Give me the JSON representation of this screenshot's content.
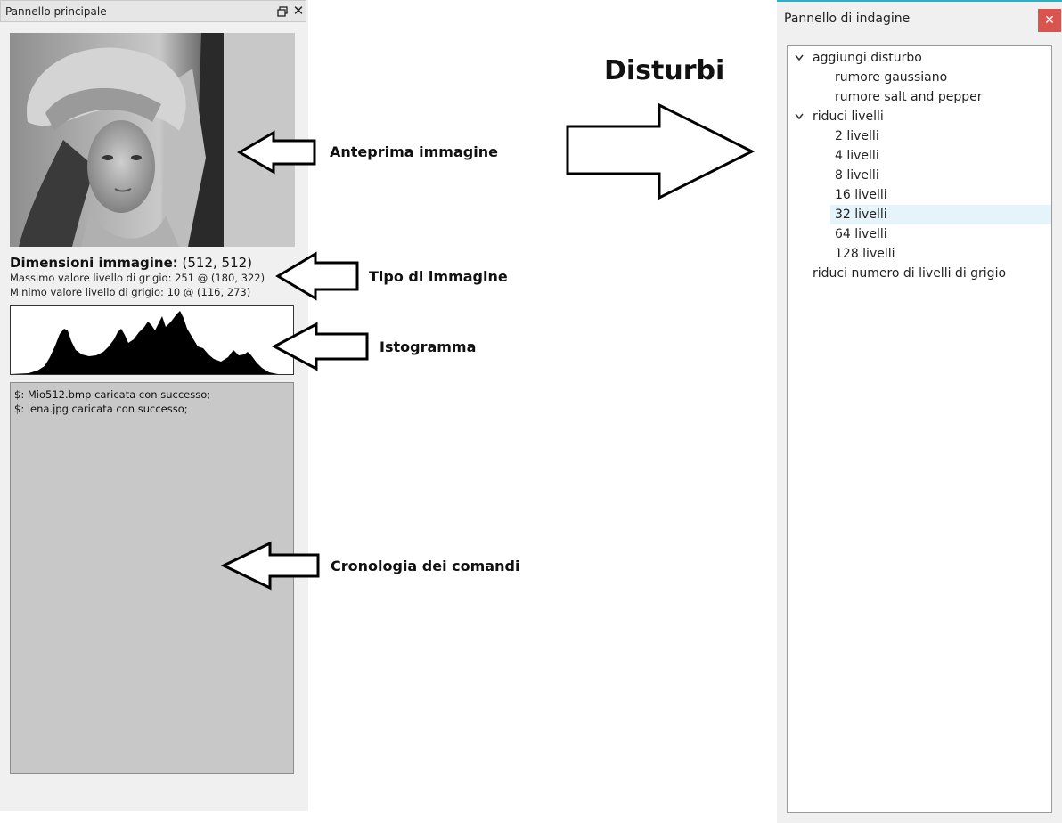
{
  "left_panel": {
    "title": "Pannello principale",
    "dimensions_label": "Dimensioni immagine:",
    "dimensions_value": "(512, 512)",
    "max_line": "Massimo valore livello di grigio: 251 @ (180, 322)",
    "min_line": "Minimo valore livello di grigio: 10 @ (116, 273)",
    "console_lines": [
      "$: Mio512.bmp caricata con successo;",
      "$: lena.jpg caricata con successo;"
    ]
  },
  "annotations": {
    "heading": "Disturbi",
    "preview": "Anteprima immagine",
    "type": "Tipo di immagine",
    "histogram": "Istogramma",
    "history": "Cronologia dei comandi"
  },
  "right_panel": {
    "title": "Pannello di indagine",
    "close_icon": "close-icon",
    "tree": [
      {
        "label": "aggiungi disturbo",
        "expanded": true
      },
      {
        "label": "rumore gaussiano"
      },
      {
        "label": "rumore salt and pepper"
      },
      {
        "label": "riduci livelli",
        "expanded": true
      },
      {
        "label": "2 livelli"
      },
      {
        "label": "4 livelli"
      },
      {
        "label": "8 livelli"
      },
      {
        "label": "16 livelli"
      },
      {
        "label": "32 livelli",
        "selected": true
      },
      {
        "label": "64 livelli"
      },
      {
        "label": "128 livelli"
      },
      {
        "label": "riduci numero di livelli di grigio"
      }
    ]
  },
  "colors": {
    "accent": "#26b3c9",
    "close_button": "#d9534f",
    "selection": "#e5f3fb"
  }
}
